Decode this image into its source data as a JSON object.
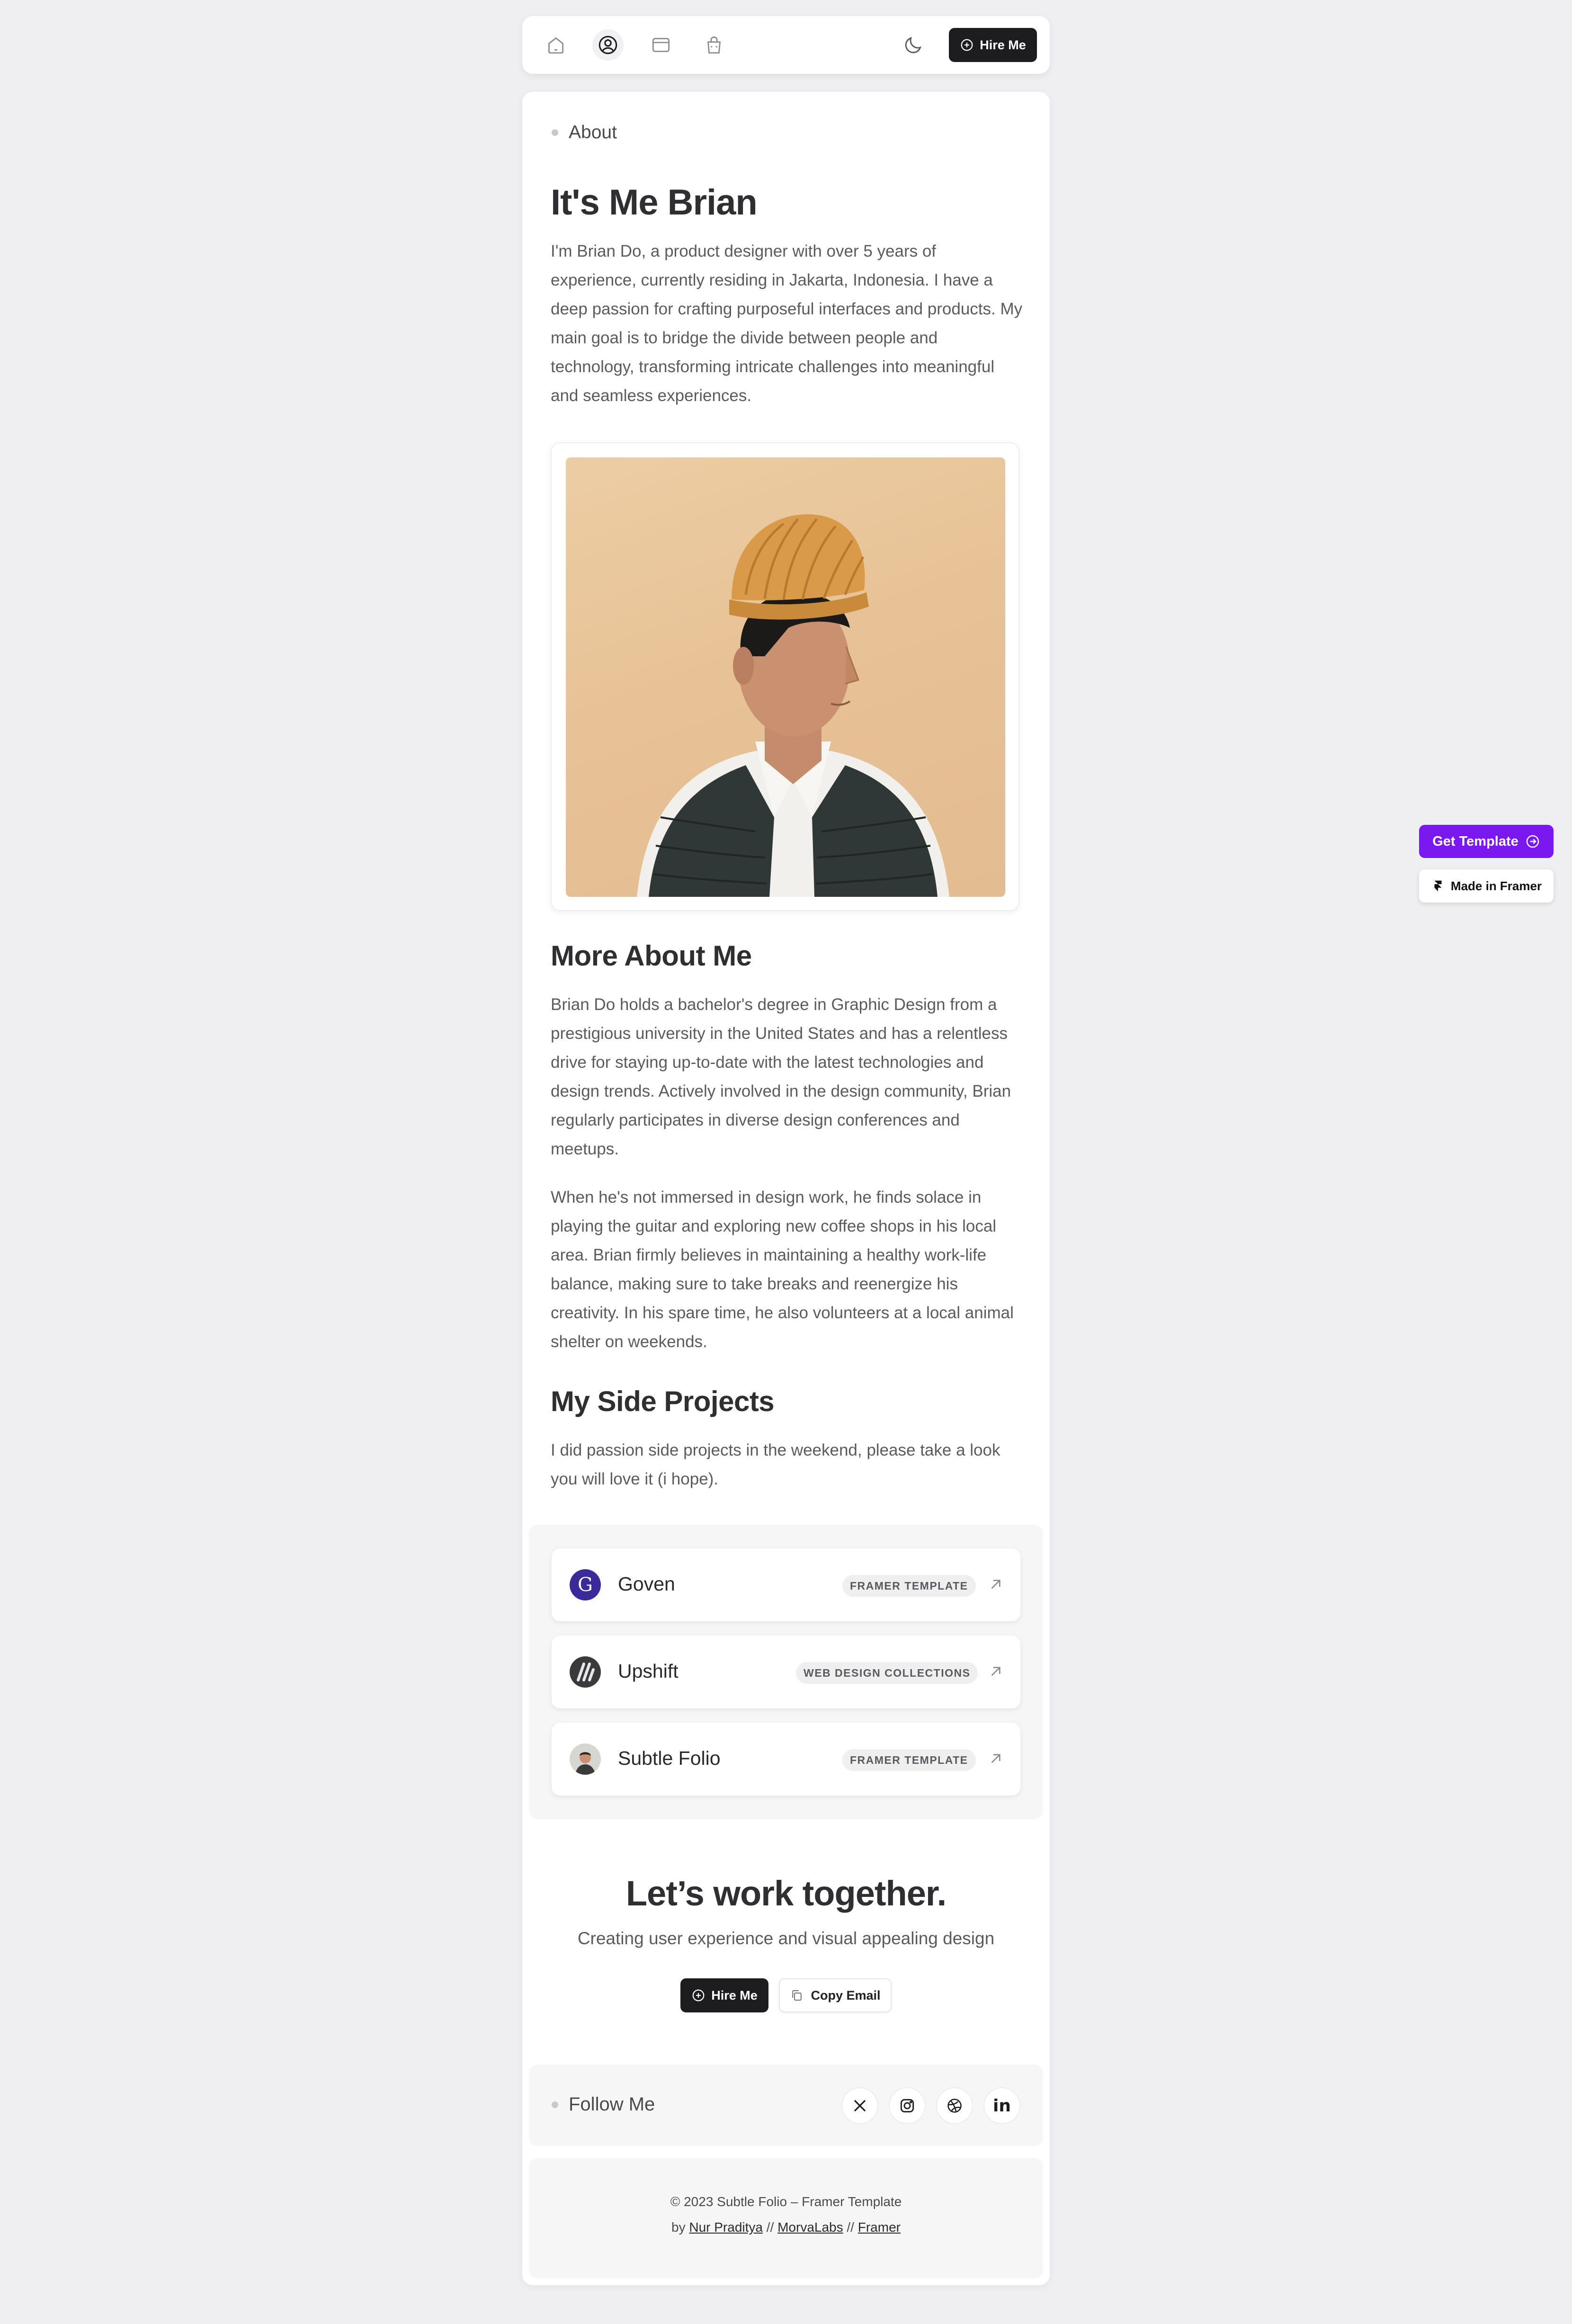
{
  "nav": {
    "icons": [
      "home-icon",
      "user-circle-icon",
      "card-icon",
      "bag-icon"
    ],
    "theme_icon": "moon-icon",
    "hire_label": "Hire Me"
  },
  "about": {
    "crumb": "About",
    "title": "It's Me Brian",
    "intro": "I'm Brian Do, a product designer with over 5 years of experience, currently residing in Jakarta, Indonesia. I have a deep passion for crafting purposeful interfaces and products. My main goal is to bridge the divide between people and technology, transforming intricate challenges into meaningful and seamless experiences."
  },
  "more": {
    "title": "More About Me",
    "p1": "Brian Do holds a bachelor's degree in Graphic Design from a prestigious university in the United States and has a relentless drive for staying up-to-date with the latest technologies and design trends. Actively involved in the design community, Brian regularly participates in diverse design conferences and meetups.",
    "p2": "When he's not immersed in design work, he finds solace in playing the guitar and exploring new coffee shops in his local area. Brian firmly believes in maintaining a healthy work-life balance, making sure to take breaks and reenergize his creativity. In his spare time, he also volunteers at a local animal shelter on weekends."
  },
  "side": {
    "title": "My Side Projects",
    "desc": "I did passion side projects in the weekend, please take a look you will love it (i hope).",
    "projects": [
      {
        "name": "Goven",
        "tag": "FRAMER TEMPLATE"
      },
      {
        "name": "Upshift",
        "tag": "WEB DESIGN COLLECTIONS"
      },
      {
        "name": "Subtle Folio",
        "tag": "FRAMER TEMPLATE"
      }
    ]
  },
  "cta": {
    "title": "Let’s work together.",
    "subtitle": "Creating user experience and visual appealing design",
    "hire_label": "Hire Me",
    "copy_label": "Copy Email"
  },
  "follow": {
    "label": "Follow Me",
    "socials": [
      "x-icon",
      "instagram-icon",
      "dribbble-icon",
      "linkedin-icon"
    ],
    "linkedin_text": "in"
  },
  "footer": {
    "line1": "© 2023 Subtle Folio – Framer Template",
    "by": "by",
    "author": "Nur Praditya",
    "sep": "//",
    "studio": "MorvaLabs",
    "platform": "Framer"
  },
  "badges": {
    "get_template": "Get Template",
    "made_in_framer": "Made in Framer"
  },
  "colors": {
    "accent": "#7b17ef",
    "dark_button": "#1d1d1f",
    "background": "#efeff1"
  }
}
